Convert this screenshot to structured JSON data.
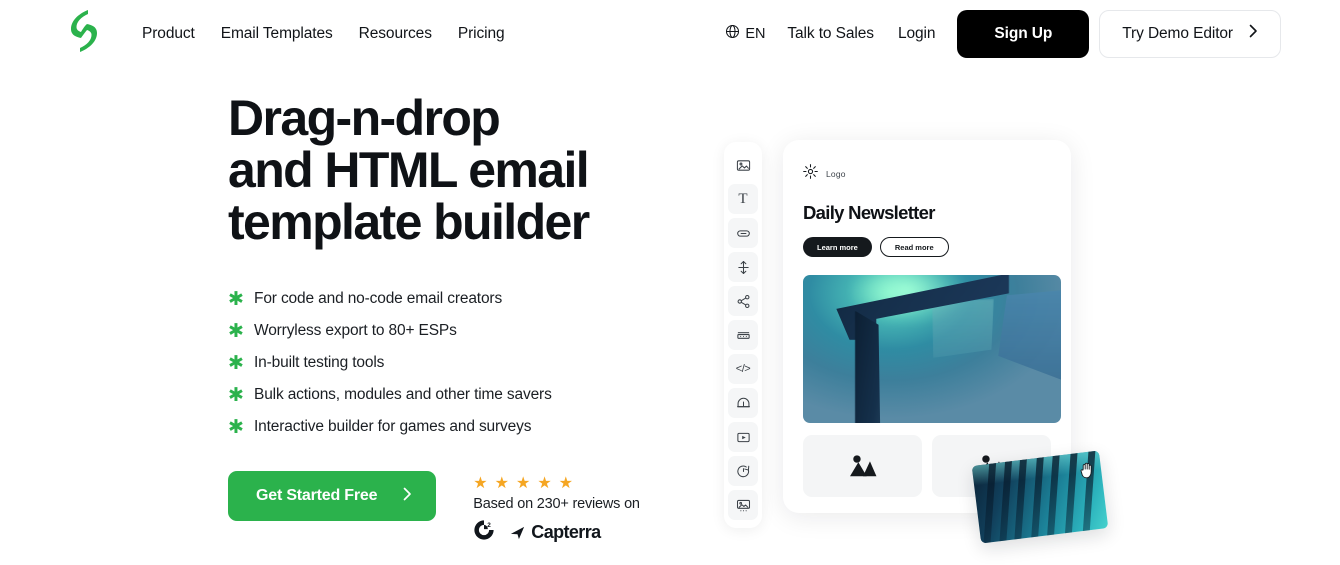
{
  "header": {
    "logo_icon": "stripo-logo-icon",
    "nav": [
      {
        "label": "Product"
      },
      {
        "label": "Email Templates"
      },
      {
        "label": "Resources"
      },
      {
        "label": "Pricing"
      }
    ],
    "language": {
      "icon": "globe-icon",
      "label": "EN"
    },
    "talk_to_sales": "Talk to Sales",
    "login": "Login",
    "signup": "Sign Up",
    "demo": {
      "label": "Try Demo Editor",
      "icon": "chevron-right-icon"
    }
  },
  "hero": {
    "headline": "Drag-n-drop\nand HTML email\ntemplate builder",
    "features": [
      "For code and no-code email creators",
      "Worryless export to 80+ ESPs",
      "In-built testing tools",
      "Bulk actions, modules and other time savers",
      "Interactive builder for games and surveys"
    ],
    "bullet_icon": "asterisk-icon",
    "cta": {
      "label": "Get Started Free",
      "icon": "chevron-right-icon"
    },
    "reviews": {
      "stars": 5,
      "star_icon": "star-icon",
      "text": "Based on 230+ reviews on",
      "logos": [
        {
          "name": "g2-logo",
          "label": "G2"
        },
        {
          "name": "capterra-logo",
          "label": "Capterra"
        }
      ]
    }
  },
  "editor": {
    "toolbar": [
      {
        "icon": "image-block-icon",
        "active": true
      },
      {
        "icon": "text-block-icon",
        "active": false
      },
      {
        "icon": "button-block-icon",
        "active": false
      },
      {
        "icon": "spacer-block-icon",
        "active": false
      },
      {
        "icon": "social-share-icon",
        "active": false
      },
      {
        "icon": "menu-block-icon",
        "active": false
      },
      {
        "icon": "html-code-icon",
        "active": false
      },
      {
        "icon": "banner-block-icon",
        "active": false
      },
      {
        "icon": "video-block-icon",
        "active": false
      },
      {
        "icon": "timer-block-icon",
        "active": false
      },
      {
        "icon": "carousel-block-icon",
        "active": false
      }
    ],
    "card": {
      "brand_icon": "sun-burst-logo-icon",
      "brand_label": "Logo",
      "title": "Daily Newsletter",
      "buttons": [
        {
          "label": "Learn more",
          "style": "dark"
        },
        {
          "label": "Read more",
          "style": "light"
        }
      ],
      "hero_image_alt": "abstract-blue-architecture-image",
      "placeholders": [
        {
          "icon": "image-placeholder-icon"
        },
        {
          "icon": "image-placeholder-icon"
        }
      ]
    },
    "drag": {
      "image_alt": "dragged-teal-architecture-image",
      "cursor_icon": "grab-hand-cursor-icon"
    }
  },
  "colors": {
    "brand_green": "#2bb24c",
    "cta_green": "#2bb24c",
    "dark": "#000000",
    "star_orange": "#f5a623",
    "text": "#111418"
  }
}
